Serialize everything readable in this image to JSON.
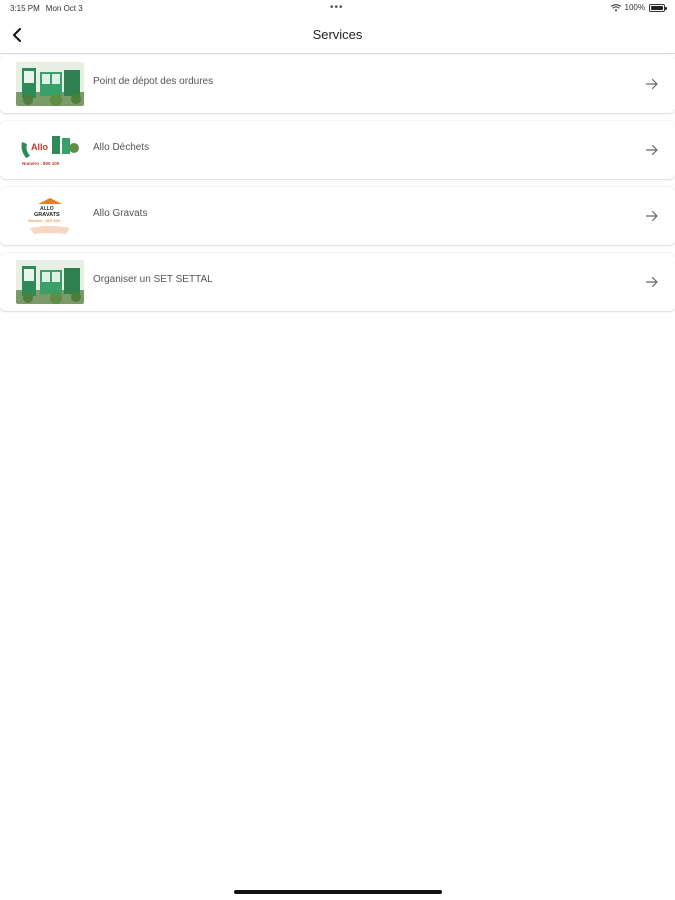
{
  "status_bar": {
    "time": "3:15 PM",
    "date": "Mon Oct 3",
    "dots": "•••",
    "battery_text": "100%",
    "wifi_icon": "wifi-icon",
    "battery_level": 1.0
  },
  "nav": {
    "title": "Services",
    "back_icon": "chevron-left-icon"
  },
  "services": [
    {
      "label": "Point de dépot des ordures",
      "thumb": "depot-photo",
      "arrow_icon": "arrow-right-icon"
    },
    {
      "label": "Allo Déchets",
      "thumb": "allo-dechets-logo",
      "arrow_icon": "arrow-right-icon"
    },
    {
      "label": "Allo Gravats",
      "thumb": "allo-gravats-logo",
      "arrow_icon": "arrow-right-icon"
    },
    {
      "label": "Organiser un SET SETTAL",
      "thumb": "depot-photo",
      "arrow_icon": "arrow-right-icon"
    }
  ],
  "colors": {
    "accent_green": "#2e8b57",
    "red": "#c0392b",
    "orange": "#e67e22"
  }
}
